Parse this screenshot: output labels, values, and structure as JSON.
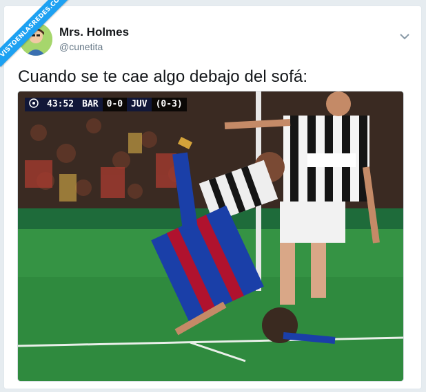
{
  "watermark": "VISTOENLASREDES.COM",
  "author": {
    "name": "Mrs. Holmes",
    "handle": "@cunetita"
  },
  "tweet": {
    "text": "Cuando se te cae algo debajo del sofá:"
  },
  "score": {
    "time": "43:52",
    "home": "BAR",
    "score": "0-0",
    "away": "JUV",
    "aggregate": "(0-3)"
  },
  "icons": [
    "chevron-down-icon",
    "champions-league-icon"
  ],
  "colors": {
    "brand": "#1da1f2",
    "pitch": "#2f8a3e",
    "barca_blue": "#1a3fa8",
    "barca_red": "#b0122e"
  }
}
